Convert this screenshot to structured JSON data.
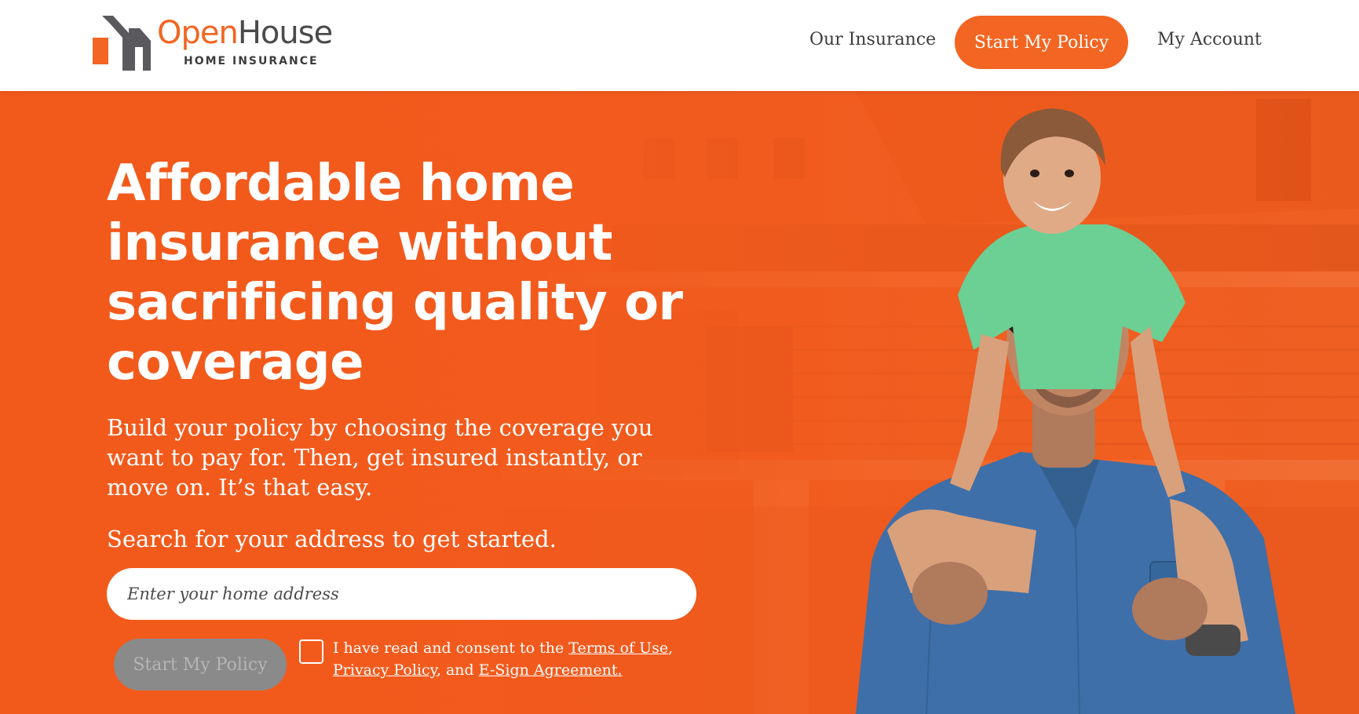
{
  "header": {
    "logo": {
      "word_open": "Open",
      "word_house": "House",
      "tagline": "HOME INSURANCE"
    },
    "nav": {
      "our_insurance": "Our Insurance",
      "start_policy": "Start My Policy",
      "my_account": "My Account"
    }
  },
  "hero": {
    "headline": "Affordable home insurance without sacrificing quality or coverage",
    "subtext": "Build your policy by choosing the coverage you want to pay for. Then, get insured instantly, or move on. It’s that easy.",
    "search_label": "Search for your address to get started.",
    "address_placeholder": "Enter your home address",
    "start_button": "Start My Policy",
    "consent": {
      "prefix": "I have read and consent to the ",
      "terms": "Terms of Use",
      "comma": ",",
      "privacy": "Privacy Policy",
      "and": ", and ",
      "esign": "E-Sign Agreement."
    }
  },
  "colors": {
    "brand_orange": "#f26522",
    "hero_orange": "#f05a1a",
    "disabled_gray": "#8a8a8a"
  },
  "icons": {
    "logo_mark": "house-logo-icon",
    "consent_checkbox": "checkbox-icon"
  }
}
